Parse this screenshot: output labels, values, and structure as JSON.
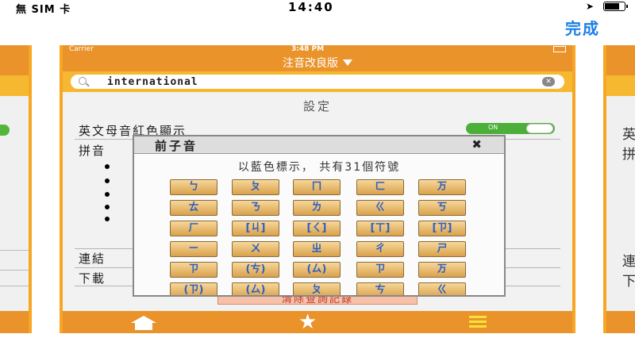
{
  "status_bar": {
    "carrier": "無 SIM 卡",
    "time": "14:40"
  },
  "done_label": "完成",
  "inner": {
    "carrier": "Carrier",
    "time": "3:48 PM",
    "nav_title": "注音改良版",
    "search_value": "international",
    "section_title": "設定",
    "row_vowel_red": "英文母音紅色顯示",
    "row_pinyin": "拼音",
    "toggle_label": "ON",
    "row_link": "連結",
    "row_download": "下載",
    "clear_history": "清除查詢記錄"
  },
  "popup": {
    "title": "前子音",
    "close_symbol": "✖",
    "subtitle": "以藍色標示， 共有31個符號",
    "keys": [
      "ㄅ",
      "ㄆ",
      "ㄇ",
      "ㄈ",
      "ㄪ",
      "ㄊ",
      "ㄋ",
      "ㄌ",
      "ㄍ",
      "ㄎ",
      "ㄏ",
      "[ㄐ]",
      "[ㄑ]",
      "[ㄒ]",
      "[ㄗ]",
      "ㄧ",
      "ㄨ",
      "ㄓ",
      "ㄔ",
      "ㄕ",
      "ㄗ",
      "(ㄘ)",
      "(ㄙ)",
      "ㄗ",
      "ㄪ",
      "(ㄗ)",
      "(ㄙ)",
      "ㄆ",
      "ㄘ",
      "ㄍ"
    ]
  },
  "side_left": {
    "text": ""
  },
  "side_right": {
    "text1": "英",
    "text2": "拼",
    "text3": "連",
    "text4": "下"
  },
  "colors": {
    "accent_orange": "#e9932a",
    "search_yellow": "#f6b830",
    "key_text_blue": "#2d5fc4",
    "done_blue": "#1a7ee6"
  },
  "icons": {
    "home": "home-icon",
    "star": "star-icon",
    "menu": "menu-icon",
    "search": "search-icon",
    "clear": "clear-icon"
  }
}
